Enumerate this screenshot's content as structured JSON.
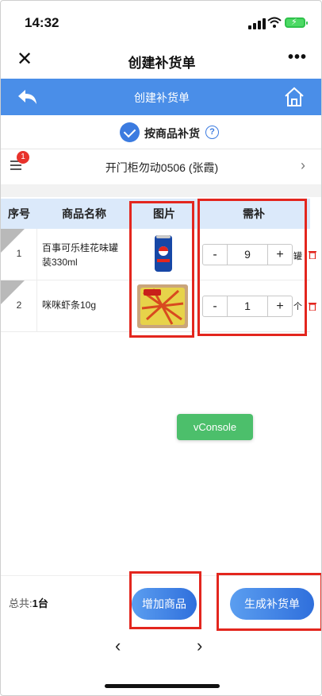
{
  "status_bar": {
    "time": "14:32",
    "battery_icon": "charging-battery-icon"
  },
  "nav": {
    "title": "创建补货单",
    "close_label": "✕",
    "more_label": "•••"
  },
  "header": {
    "title": "创建补货单"
  },
  "mode": {
    "label": "按商品补货",
    "help": "?"
  },
  "cabinet": {
    "name": "开门柜勿动0506 (张霞)",
    "badge": "1"
  },
  "table": {
    "columns": [
      "序号",
      "商品名称",
      "图片",
      "需补"
    ],
    "rows": [
      {
        "index": "1",
        "name": "百事可乐桂花味罐装330ml",
        "quantity": "9",
        "unit": "罐",
        "minus": "-",
        "plus": "+"
      },
      {
        "index": "2",
        "name": "咪咪虾条10g",
        "quantity": "1",
        "unit": "个",
        "minus": "-",
        "plus": "+"
      }
    ]
  },
  "vconsole": {
    "label": "vConsole"
  },
  "footer": {
    "total_label": "总共:",
    "total_value": "1台",
    "add_button": "增加商品",
    "generate_button": "生成补货单"
  },
  "pager": {
    "prev": "‹",
    "next": "›"
  },
  "colors": {
    "primary_blue": "#4a8ee8",
    "highlight_red": "#e3261e",
    "vconsole_green": "#4cbf6b"
  }
}
